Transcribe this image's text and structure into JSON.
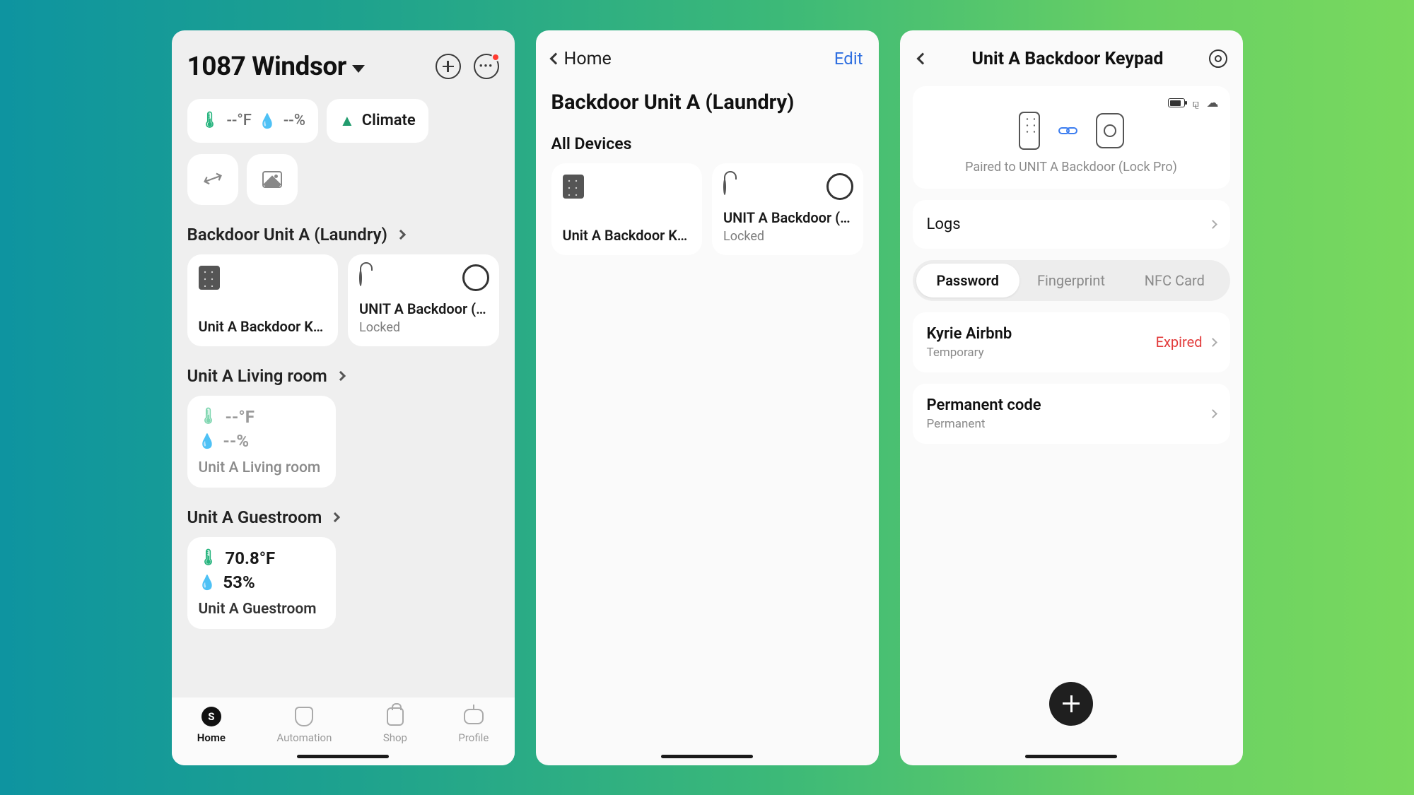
{
  "screen1": {
    "home_name": "1087 Windsor",
    "status_chip": {
      "temp": "--°F",
      "humidity": "--%"
    },
    "climate_chip": "Climate",
    "sections": {
      "backdoor": {
        "title": "Backdoor Unit A (Laundry)",
        "keypad_card": "Unit A Backdoor Key…",
        "lock_card": {
          "name": "UNIT A Backdoor (Lo…",
          "status": "Locked"
        }
      },
      "living": {
        "title": "Unit A Living room",
        "temp": "--°F",
        "humidity": "--%",
        "room": "Unit A Living room"
      },
      "guest": {
        "title": "Unit A Guestroom",
        "temp": "70.8°F",
        "humidity": "53%",
        "room": "Unit A Guestroom"
      }
    },
    "tabs": {
      "home": "Home",
      "automation": "Automation",
      "shop": "Shop",
      "profile": "Profile"
    }
  },
  "screen2": {
    "back": "Home",
    "edit": "Edit",
    "title": "Backdoor Unit A (Laundry)",
    "subtitle": "All Devices",
    "keypad_card": "Unit A Backdoor Key…",
    "lock_card": {
      "name": "UNIT A Backdoor (Lo…",
      "status": "Locked"
    }
  },
  "screen3": {
    "title": "Unit A Backdoor Keypad",
    "paired_to": "Paired to UNIT A Backdoor (Lock Pro)",
    "logs": "Logs",
    "tabs": {
      "password": "Password",
      "fingerprint": "Fingerprint",
      "nfc": "NFC Card"
    },
    "entries": {
      "kyrie": {
        "name": "Kyrie Airbnb",
        "type": "Temporary",
        "status": "Expired"
      },
      "perm": {
        "name": "Permanent code",
        "type": "Permanent"
      }
    }
  }
}
